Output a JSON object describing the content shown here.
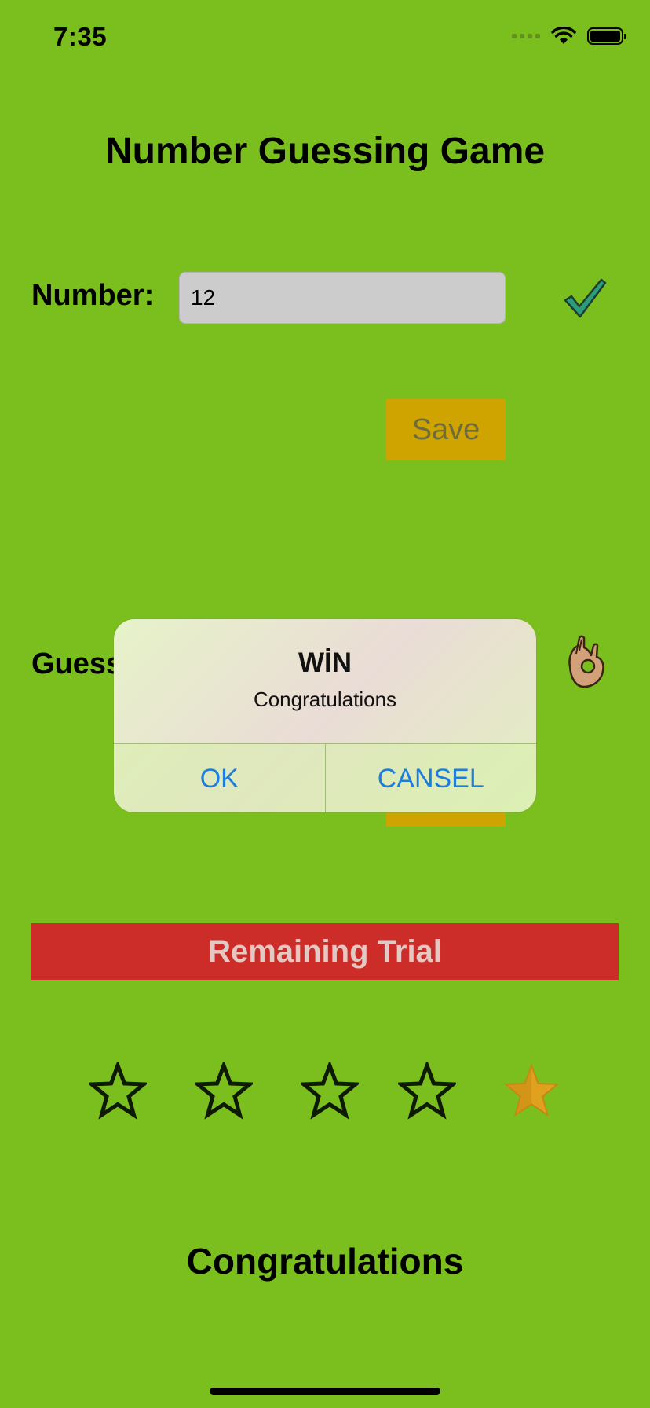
{
  "status_bar": {
    "time": "7:35"
  },
  "title": "Number Guessing Game",
  "number_section": {
    "label": "Number:",
    "value": "12",
    "save_label": "Save"
  },
  "guess_section": {
    "label": "Guess",
    "button_label": ""
  },
  "remaining": {
    "label": "Remaining Trial",
    "total": 5,
    "remaining": 1
  },
  "result_text": "Congratulations",
  "alert": {
    "title": "WİN",
    "message": "Congratulations",
    "ok_label": "OK",
    "cancel_label": "CANSEL"
  },
  "colors": {
    "background": "#7bbf1e",
    "save_button": "#cfa300",
    "remaining_bar": "#cc2d28",
    "filled_star": "#e0a21e",
    "alert_button_text": "#1a7ee0"
  },
  "icons": {
    "check": "checkmark-icon",
    "ok_hand": "ok-hand-icon",
    "star_empty": "star-outline-icon",
    "star_filled": "star-filled-icon"
  }
}
